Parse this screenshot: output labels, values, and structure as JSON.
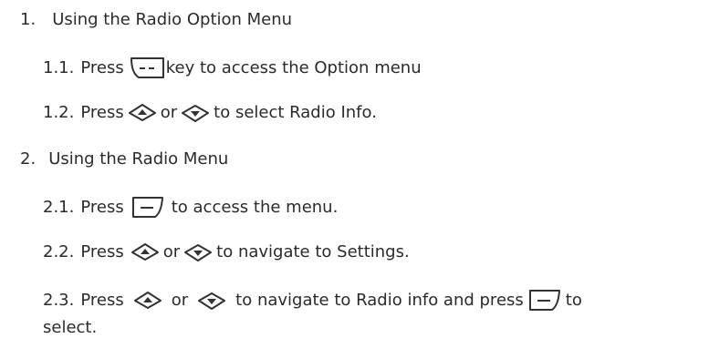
{
  "steps": [
    {
      "number": "1.",
      "title": "Using the Radio Option Menu",
      "substeps": [
        {
          "number": "1.1.",
          "before": "Press",
          "key_icon": "option-key-icon",
          "after": "key to access the Option menu"
        },
        {
          "number": "1.2.",
          "before": "Press",
          "up_icon": "up-key-icon",
          "or": "or",
          "down_icon": "down-key-icon",
          "after": "to select Radio Info."
        }
      ]
    },
    {
      "number": "2.",
      "title": "Using the Radio Menu",
      "substeps": [
        {
          "number": "2.1.",
          "before": "Press",
          "key_icon": "menu-ok-key-icon",
          "after": "to access the menu."
        },
        {
          "number": "2.2.",
          "before": "Press",
          "up_icon": "up-key-icon",
          "or": "or",
          "down_icon": "down-key-icon",
          "after": "to navigate to Settings."
        },
        {
          "number": "2.3.",
          "before": "Press",
          "up_icon": "up-key-icon",
          "or": "or",
          "down_icon": "down-key-icon",
          "middle": "to navigate to Radio info and press",
          "ok_icon": "menu-ok-key-icon",
          "after": "to",
          "continuation": "select."
        }
      ]
    }
  ]
}
